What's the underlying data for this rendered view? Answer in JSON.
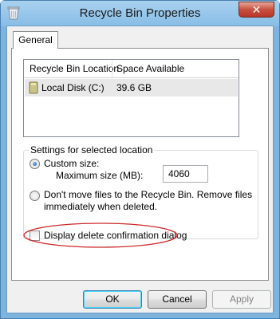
{
  "window": {
    "title": "Recycle Bin Properties",
    "close_symbol": "✕",
    "icon": "recycle-bin-icon"
  },
  "tabs": [
    {
      "label": "General",
      "selected": true
    }
  ],
  "location_list": {
    "columns": [
      "Recycle Bin Location",
      "Space Available"
    ],
    "rows": [
      {
        "location": "Local Disk (C:)",
        "space": "39.6 GB",
        "icon": "drive-icon"
      }
    ]
  },
  "settings": {
    "group_label": "Settings for selected location",
    "custom_size_label": "Custom size:",
    "max_size_label": "Maximum size (MB):",
    "max_size_value": "4060",
    "dont_move_label_line1": "Don't move files to the Recycle Bin. Remove files",
    "dont_move_label_line2": "immediately when deleted.",
    "selected_option": "custom_size"
  },
  "confirm": {
    "label": "Display delete confirmation dialog",
    "checked": false,
    "highlight_color": "#cc2a2a"
  },
  "buttons": {
    "ok": "OK",
    "cancel": "Cancel",
    "apply": "Apply"
  }
}
